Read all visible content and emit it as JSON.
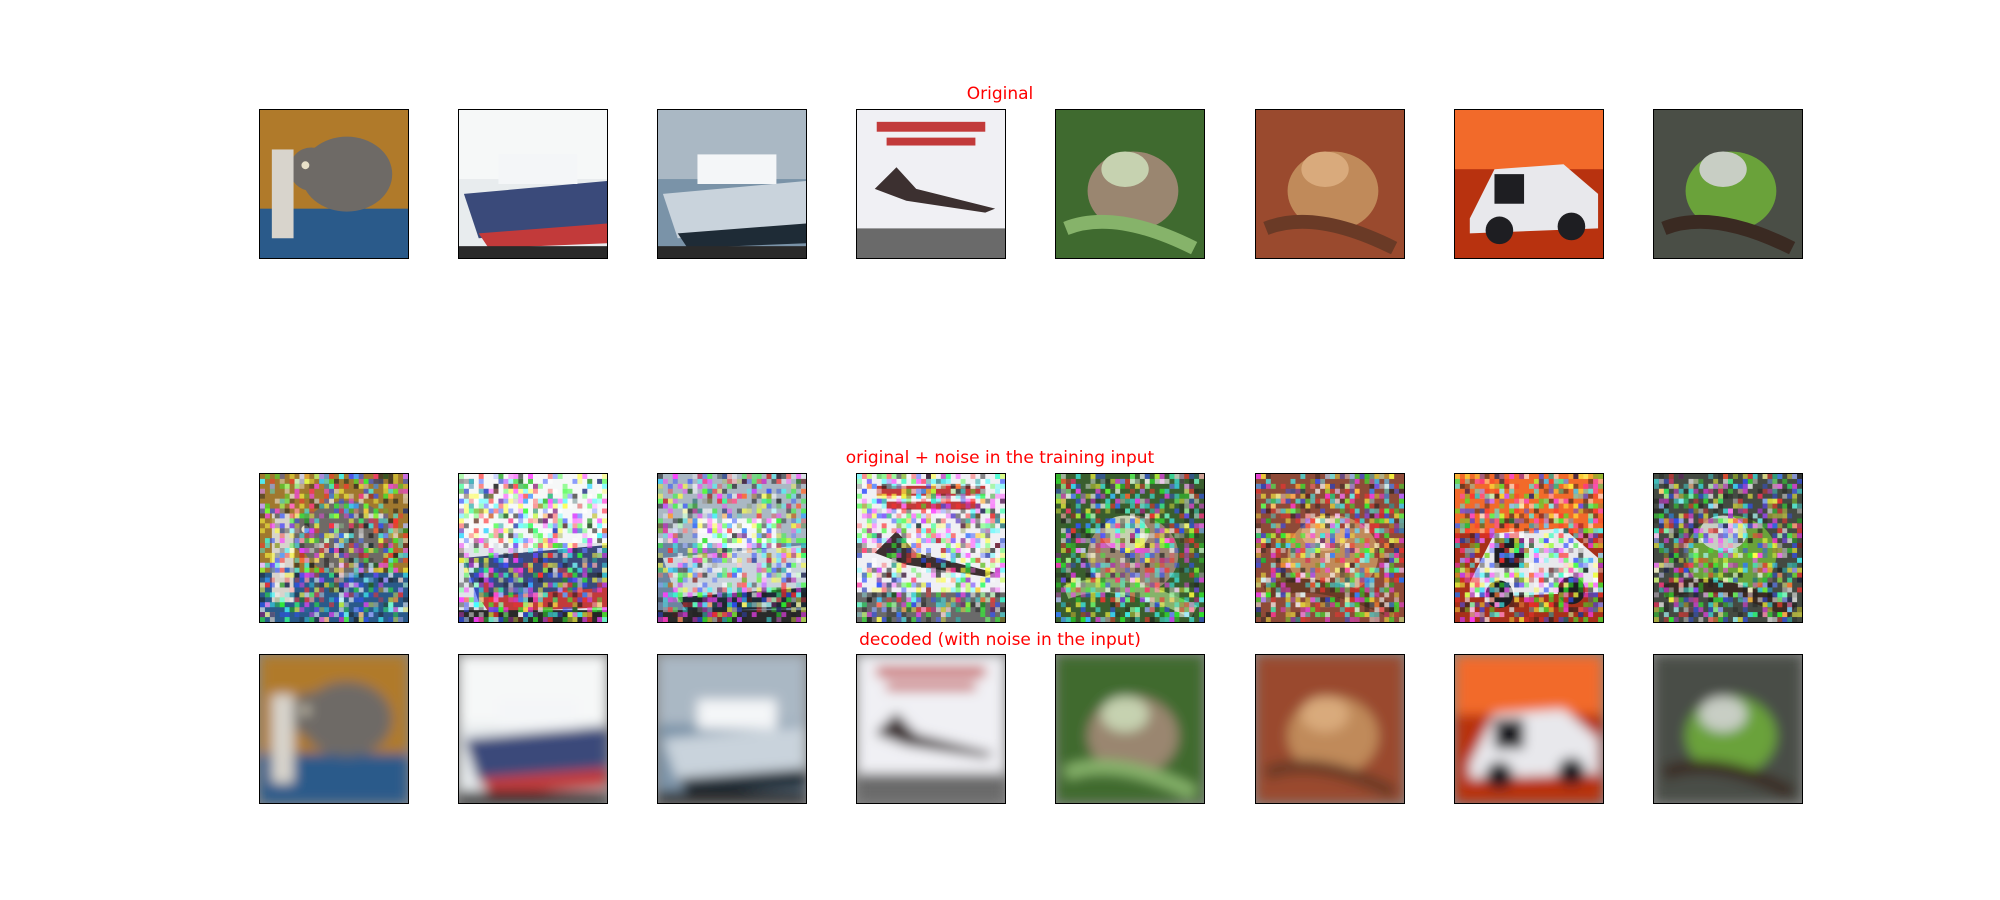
{
  "figure": {
    "rows": [
      {
        "id": "original",
        "title": "Original",
        "rendering": "sharp",
        "images": [
          {
            "subject": "cat",
            "palette": {
              "bg": "#b07a2a",
              "main": "#6e6a66",
              "accent": "#2a5a8a",
              "light": "#d8d4cc"
            }
          },
          {
            "subject": "ship",
            "palette": {
              "bg": "#e8ecee",
              "main": "#3a4a7a",
              "accent": "#c23a3a",
              "light": "#f6f8f8"
            }
          },
          {
            "subject": "ship",
            "palette": {
              "bg": "#7a93a8",
              "main": "#c9d3dc",
              "accent": "#1e2b36",
              "light": "#aab8c4"
            }
          },
          {
            "subject": "airplane",
            "palette": {
              "bg": "#dcdde6",
              "main": "#3c3030",
              "accent": "#c23a3a",
              "light": "#f0f0f4"
            }
          },
          {
            "subject": "frog",
            "palette": {
              "bg": "#3f6a2f",
              "main": "#9a8670",
              "accent": "#86b36a",
              "light": "#c6d2b0"
            }
          },
          {
            "subject": "frog",
            "palette": {
              "bg": "#9a4a2e",
              "main": "#c08a5a",
              "accent": "#6a3a26",
              "light": "#d9aa7c"
            }
          },
          {
            "subject": "automobile",
            "palette": {
              "bg": "#b8320f",
              "main": "#e8e8ec",
              "accent": "#1e1e22",
              "light": "#f26a2a"
            }
          },
          {
            "subject": "frog",
            "palette": {
              "bg": "#4a4e46",
              "main": "#6aa23a",
              "accent": "#3a2a22",
              "light": "#c8cec4"
            }
          }
        ]
      },
      {
        "id": "noisy",
        "title": "original + noise in the training input",
        "rendering": "noisy",
        "images": [
          {
            "subject": "cat",
            "palette": {
              "bg": "#a0782e",
              "main": "#6e6a66",
              "accent": "#2a5a8a",
              "light": "#d8d4cc"
            }
          },
          {
            "subject": "ship",
            "palette": {
              "bg": "#dfe4ea",
              "main": "#3a4a7a",
              "accent": "#c23a3a",
              "light": "#f6f8f8"
            }
          },
          {
            "subject": "ship",
            "palette": {
              "bg": "#6c84a0",
              "main": "#c9d3dc",
              "accent": "#1e2b36",
              "light": "#aab8c4"
            }
          },
          {
            "subject": "airplane",
            "palette": {
              "bg": "#d4d2e2",
              "main": "#3c3030",
              "accent": "#c23a3a",
              "light": "#f0f0f4"
            }
          },
          {
            "subject": "frog",
            "palette": {
              "bg": "#3a5e2e",
              "main": "#9a8670",
              "accent": "#86b36a",
              "light": "#c6d2b0"
            }
          },
          {
            "subject": "frog",
            "palette": {
              "bg": "#8e4a38",
              "main": "#c08a5a",
              "accent": "#6a3a26",
              "light": "#d9aa7c"
            }
          },
          {
            "subject": "automobile",
            "palette": {
              "bg": "#a8301a",
              "main": "#e8e8ec",
              "accent": "#1e1e22",
              "light": "#f26a2a"
            }
          },
          {
            "subject": "frog",
            "palette": {
              "bg": "#444a42",
              "main": "#6aa23a",
              "accent": "#3a2a22",
              "light": "#c8cec4"
            }
          }
        ]
      },
      {
        "id": "decoded",
        "title": "decoded (with noise in the input)",
        "rendering": "blurred",
        "images": [
          {
            "subject": "cat",
            "palette": {
              "bg": "#b07a2a",
              "main": "#6e6a66",
              "accent": "#2a5a8a",
              "light": "#d8d4cc"
            }
          },
          {
            "subject": "ship",
            "palette": {
              "bg": "#e8ecee",
              "main": "#3a4a7a",
              "accent": "#c23a3a",
              "light": "#f6f8f8"
            }
          },
          {
            "subject": "ship",
            "palette": {
              "bg": "#7a93a8",
              "main": "#c9d3dc",
              "accent": "#1e2b36",
              "light": "#aab8c4"
            }
          },
          {
            "subject": "airplane",
            "palette": {
              "bg": "#dcdde6",
              "main": "#3c3030",
              "accent": "#c23a3a",
              "light": "#f0f0f4"
            }
          },
          {
            "subject": "frog",
            "palette": {
              "bg": "#3f6a2f",
              "main": "#9a8670",
              "accent": "#86b36a",
              "light": "#c6d2b0"
            }
          },
          {
            "subject": "frog",
            "palette": {
              "bg": "#9a4a2e",
              "main": "#c08a5a",
              "accent": "#6a3a26",
              "light": "#d9aa7c"
            }
          },
          {
            "subject": "automobile",
            "palette": {
              "bg": "#b8320f",
              "main": "#e8e8ec",
              "accent": "#1e1e22",
              "light": "#f26a2a"
            }
          },
          {
            "subject": "frog",
            "palette": {
              "bg": "#4a4e46",
              "main": "#6aa23a",
              "accent": "#3a2a22",
              "light": "#c8cec4"
            }
          }
        ]
      }
    ],
    "title_color": "#ff0000"
  }
}
